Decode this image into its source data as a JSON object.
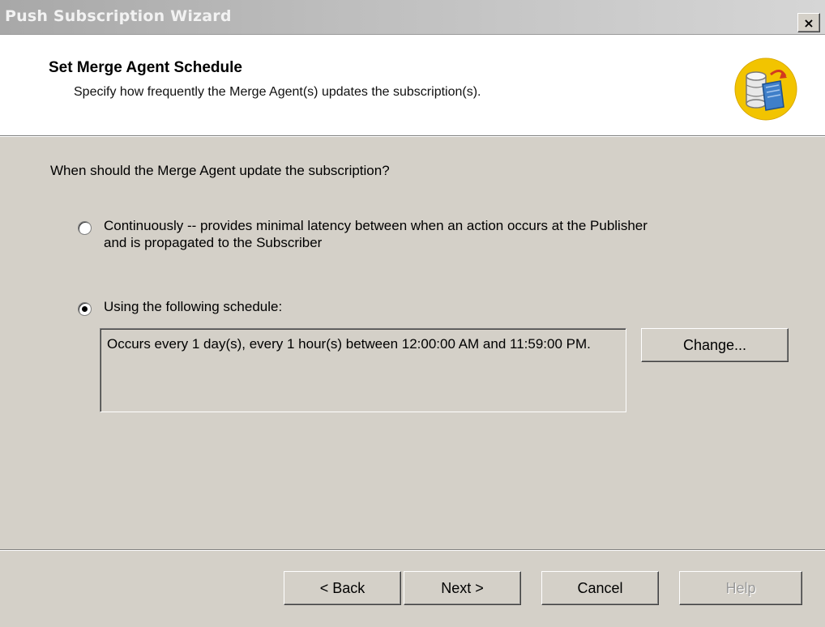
{
  "window": {
    "title": "Push Subscription Wizard",
    "close_label": "×"
  },
  "header": {
    "title": "Set Merge Agent Schedule",
    "subtitle": "Specify how frequently the Merge Agent(s) updates the subscription(s)."
  },
  "body": {
    "question": "When should the Merge Agent update the subscription?",
    "option_continuous": {
      "label_line1": "Continuously -- provides minimal latency between when an action occurs at the Publisher",
      "label_line2": "and is propagated to the Subscriber",
      "selected": false
    },
    "option_schedule": {
      "label": "Using the following schedule:",
      "selected": true
    },
    "schedule_description": "Occurs every 1 day(s), every 1 hour(s) between 12:00:00 AM and 11:59:00 PM.",
    "change_button": "Change..."
  },
  "footer": {
    "back": "< Back",
    "next": "Next >",
    "cancel": "Cancel",
    "help": "Help"
  }
}
